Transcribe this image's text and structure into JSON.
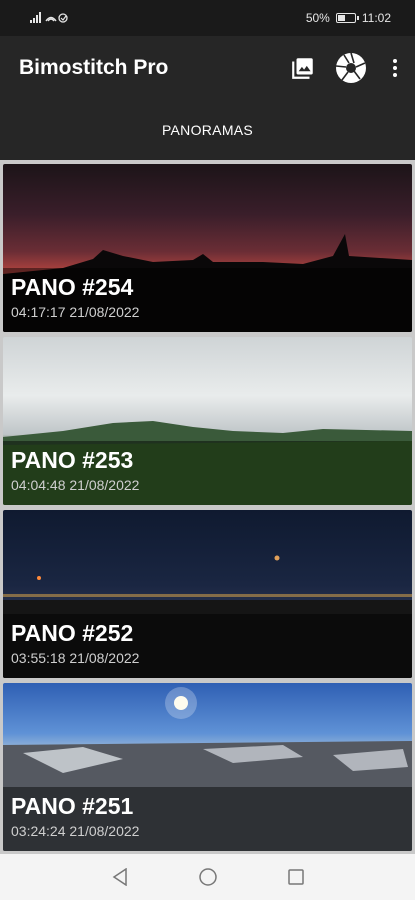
{
  "status_bar": {
    "left_text": "4G ▂▄▆ ᯤ",
    "battery_percent": "50%",
    "battery_level": 0.5,
    "time": "11:02"
  },
  "app_bar": {
    "title": "Bimostitch Pro",
    "actions": [
      {
        "name": "gallery-icon"
      },
      {
        "name": "shutter-icon"
      },
      {
        "name": "more-vert-icon"
      }
    ]
  },
  "tab": {
    "label": "PANORAMAS"
  },
  "panoramas": [
    {
      "title": "PANO #254",
      "date": "04:17:17 21/08/2022"
    },
    {
      "title": "PANO #253",
      "date": "04:04:48 21/08/2022"
    },
    {
      "title": "PANO #252",
      "date": "03:55:18 21/08/2022"
    },
    {
      "title": "PANO #251",
      "date": "03:24:24 21/08/2022"
    }
  ],
  "colors": {
    "app_bar": "#262626",
    "list_background": "#c9c9c9",
    "nav_bar": "#f4f4f4"
  }
}
